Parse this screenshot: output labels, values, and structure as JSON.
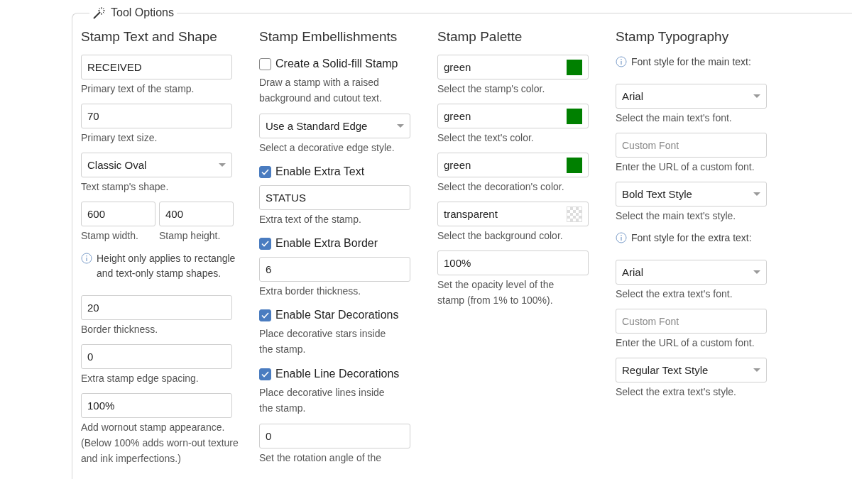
{
  "panel": {
    "title": "Tool Options"
  },
  "columns": [
    {
      "title": "Stamp Text and Shape",
      "items": [
        {
          "kind": "input",
          "value": "RECEIVED",
          "help": "Primary text of the stamp."
        },
        {
          "kind": "input",
          "value": "70",
          "help": "Primary text size."
        },
        {
          "kind": "select",
          "value": "Classic Oval",
          "help": "Text stamp's shape."
        },
        {
          "kind": "pair",
          "fields": [
            {
              "value": "600",
              "help": "Stamp width."
            },
            {
              "value": "400",
              "help": "Stamp height."
            }
          ]
        },
        {
          "kind": "note",
          "text": "Height only applies to rectangle and text-only stamp shapes."
        },
        {
          "kind": "input",
          "value": "20",
          "help": "Border thickness."
        },
        {
          "kind": "input",
          "value": "0",
          "help": "Extra stamp edge spacing."
        },
        {
          "kind": "input",
          "value": "100%",
          "help": "Add wornout stamp appearance. (Below 100% adds worn-out texture and ink imperfections.)"
        }
      ]
    },
    {
      "title": "Stamp Embellishments",
      "items": [
        {
          "kind": "checkbox",
          "label": "Create a Solid-fill Stamp",
          "checked": false,
          "help": "Draw a stamp with a raised background and cutout text."
        },
        {
          "kind": "select",
          "value": "Use a Standard Edge",
          "help": "Select a decorative edge style."
        },
        {
          "kind": "checkbox",
          "label": "Enable Extra Text",
          "checked": true
        },
        {
          "kind": "input",
          "value": "STATUS",
          "help": "Extra text of the stamp."
        },
        {
          "kind": "checkbox",
          "label": "Enable Extra Border",
          "checked": true
        },
        {
          "kind": "input",
          "value": "6",
          "help": "Extra border thickness."
        },
        {
          "kind": "checkbox",
          "label": "Enable Star Decorations",
          "checked": true,
          "help": "Place decorative stars inside the stamp."
        },
        {
          "kind": "checkbox",
          "label": "Enable Line Decorations",
          "checked": true,
          "help": "Place decorative lines inside the stamp."
        },
        {
          "kind": "input",
          "value": "0",
          "help": "Set the rotation angle of the"
        }
      ]
    },
    {
      "title": "Stamp Palette",
      "items": [
        {
          "kind": "color",
          "value": "green",
          "color": "#008000",
          "help": "Select the stamp's color."
        },
        {
          "kind": "color",
          "value": "green",
          "color": "#008000",
          "help": "Select the text's color."
        },
        {
          "kind": "color",
          "value": "green",
          "color": "#008000",
          "help": "Select the decoration's color."
        },
        {
          "kind": "color",
          "value": "transparent",
          "help": "Select the background color."
        },
        {
          "kind": "input",
          "value": "100%",
          "help": "Set the opacity level of the stamp (from 1% to 100%)."
        }
      ]
    },
    {
      "title": "Stamp Typography",
      "items": [
        {
          "kind": "note",
          "text": "Font style for the main text:"
        },
        {
          "kind": "select",
          "value": "Arial",
          "help": "Select the main text's font."
        },
        {
          "kind": "input",
          "placeholder": "Custom Font",
          "help": "Enter the URL of a custom font."
        },
        {
          "kind": "select",
          "value": "Bold Text Style",
          "help": "Select the main text's style."
        },
        {
          "kind": "note",
          "text": "Font style for the extra text:"
        },
        {
          "kind": "select",
          "value": "Arial",
          "help": "Select the extra text's font."
        },
        {
          "kind": "input",
          "placeholder": "Custom Font",
          "help": "Enter the URL of a custom font."
        },
        {
          "kind": "select",
          "value": "Regular Text Style",
          "help": "Select the extra text's style."
        }
      ]
    }
  ]
}
